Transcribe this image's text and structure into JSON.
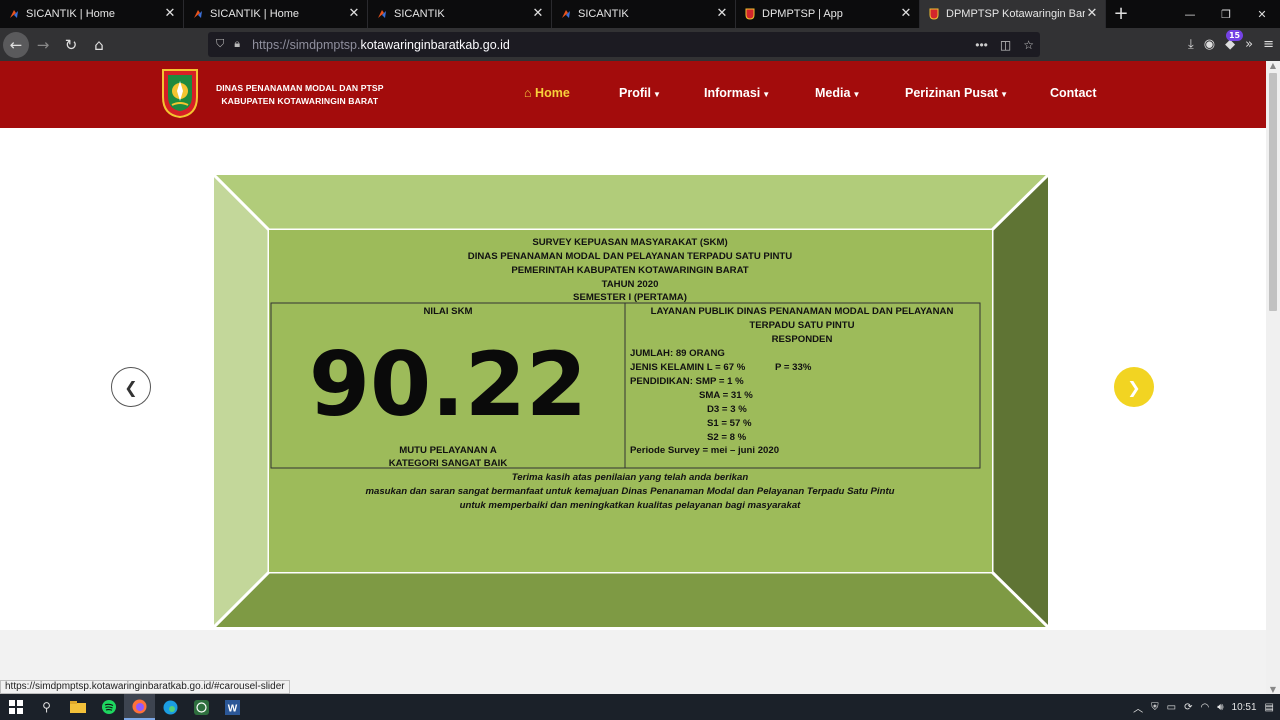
{
  "browser": {
    "tabs": [
      {
        "title": "SICANTIK | Home",
        "icon": "sicantik-favicon"
      },
      {
        "title": "SICANTIK | Home",
        "icon": "sicantik-favicon"
      },
      {
        "title": "SICANTIK",
        "icon": "sicantik-favicon"
      },
      {
        "title": "SICANTIK",
        "icon": "sicantik-favicon"
      },
      {
        "title": "DPMPTSP | App",
        "icon": "dpmptsp-favicon"
      },
      {
        "title": "DPMPTSP Kotawaringin Barat",
        "icon": "dpmptsp-favicon",
        "active": true
      }
    ],
    "url_proto": "https://simdpmptsp.",
    "url_domain": "kotawaringinbaratkab.go.id",
    "ext_badge": "15",
    "status_link": "https://simdpmptsp.kotawaringinbaratkab.go.id/#carousel-slider"
  },
  "site": {
    "brand_line1": "DINAS PENANAMAN MODAL DAN PTSP",
    "brand_line2": "KABUPATEN KOTAWARINGIN BARAT",
    "menu": [
      {
        "label": "Home",
        "has_caret": false,
        "active": true
      },
      {
        "label": "Profil",
        "has_caret": true
      },
      {
        "label": "Informasi",
        "has_caret": true
      },
      {
        "label": "Media",
        "has_caret": true
      },
      {
        "label": "Perizinan Pusat",
        "has_caret": true
      },
      {
        "label": "Contact",
        "has_caret": false
      }
    ],
    "colors": {
      "header": "#a30c0c",
      "menu_active": "#f7d13b",
      "next_arrow": "#f2d422"
    }
  },
  "banner": {
    "title_lines": [
      "SURVEY KEPUASAN MASYARAKAT (SKM)",
      "DINAS PENANAMAN MODAL DAN PELAYANAN TERPADU SATU PINTU",
      "PEMERINTAH KABUPATEN KOTAWARINGIN BARAT",
      "TAHUN 2020",
      "SEMESTER I (PERTAMA)"
    ],
    "left_header": "NILAI SKM",
    "score": "90.22",
    "quality_lines": [
      "MUTU PELAYANAN A",
      "KATEGORI SANGAT BAIK"
    ],
    "right_header_lines": [
      "LAYANAN PUBLIK DINAS PENANAMAN MODAL DAN PELAYANAN",
      "TERPADU SATU PINTU",
      "RESPONDEN"
    ],
    "stats": {
      "jumlah": "JUMLAH: 89 ORANG",
      "jenis_kelamin": "JENIS KELAMIN L = 67 %",
      "perempuan": "P = 33%",
      "pendidikan_smp": "PENDIDIKAN: SMP   =   1 %",
      "sma": "SMA   = 31 %",
      "d3": "D3   =   3 %",
      "s1": "S1    = 57 %",
      "s2": "S2    =   8 %",
      "periode": "Periode Survey  = mei – juni 2020"
    },
    "thanks_lines": [
      "Terima kasih atas penilaian yang telah anda berikan",
      "masukan dan saran sangat bermanfaat untuk kemajuan Dinas Penanaman Modal dan Pelayanan Terpadu Satu Pintu",
      "untuk memperbaiki dan meningkatkan kualitas pelayanan bagi masyarakat"
    ]
  },
  "taskbar": {
    "time": "10:51"
  }
}
